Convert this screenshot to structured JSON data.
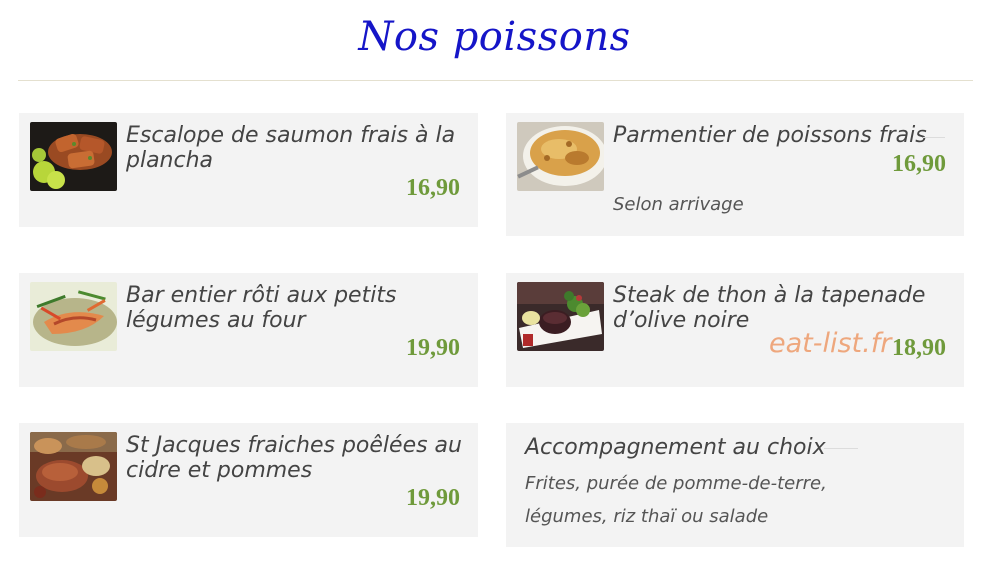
{
  "page": {
    "title": "Nos poissons",
    "watermark": "eat-list.fr"
  },
  "items": [
    {
      "name": "Escalope de saumon frais à la plancha",
      "price": "16,90",
      "image": "salmon-dish-photo"
    },
    {
      "name": "Parmentier de poissons frais",
      "price": "16,90",
      "note": "Selon arrivage",
      "image": "fish-parmentier-photo"
    },
    {
      "name": "Bar entier rôti aux petits légumes au four",
      "price": "19,90",
      "image": "sea-bass-photo"
    },
    {
      "name": "Steak de thon à la tapenade d’olive noire",
      "price": "18,90",
      "image": "tuna-steak-photo"
    },
    {
      "name": "St Jacques fraiches poêlées au cidre et pommes",
      "price": "19,90",
      "image": "scallops-photo"
    }
  ],
  "sides": {
    "title": "Accompagnement au choix",
    "line1": "Frites, purée de pomme-de-terre,",
    "line2": "légumes, riz thaï ou salade"
  },
  "colors": {
    "title": "#1515c8",
    "price": "#6f9a3b",
    "card_bg": "#f3f3f3",
    "watermark": "#eea77d"
  }
}
